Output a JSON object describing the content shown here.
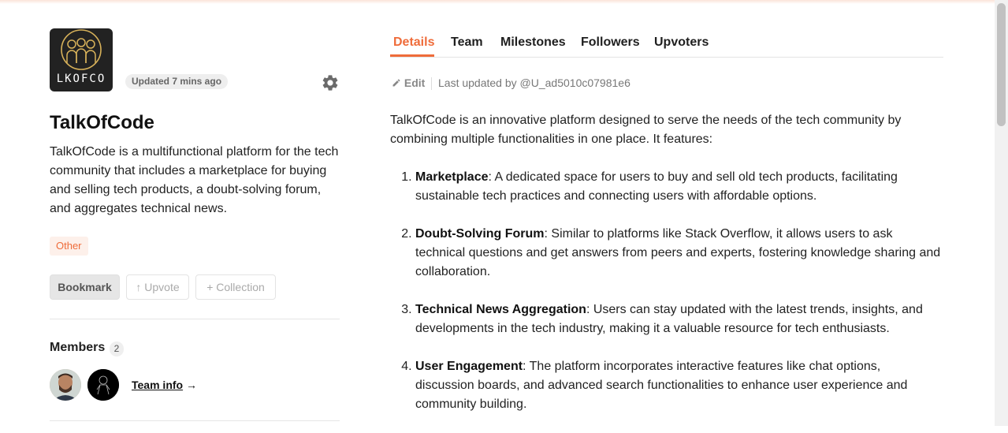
{
  "project": {
    "logo_text": "LKOFCO",
    "updated": "Updated 7 mins ago",
    "title": "TalkOfCode",
    "description": "TalkOfCode is a multifunctional platform for the tech community that includes a marketplace for buying and selling tech products, a doubt-solving forum, and aggregates technical news.",
    "tag": "Other"
  },
  "actions": {
    "bookmark": "Bookmark",
    "upvote": "↑ Upvote",
    "collection": "+ Collection"
  },
  "members": {
    "label": "Members",
    "count": "2",
    "team_info": "Team info",
    "team_info_arrow": "→"
  },
  "tabs": [
    "Details",
    "Team",
    "Milestones",
    "Followers",
    "Upvoters"
  ],
  "active_tab": "Details",
  "meta": {
    "edit": "Edit",
    "last_updated": "Last updated by @U_ad5010c07981e6"
  },
  "content": {
    "intro": "TalkOfCode is an innovative platform designed to serve the needs of the tech community by combining multiple functionalities in one place. It features:",
    "features": [
      {
        "title": "Marketplace",
        "text": ": A dedicated space for users to buy and sell old tech products, facilitating sustainable tech practices and connecting users with affordable options."
      },
      {
        "title": "Doubt-Solving Forum",
        "text": ": Similar to platforms like Stack Overflow, it allows users to ask technical questions and get answers from peers and experts, fostering knowledge sharing and collaboration."
      },
      {
        "title": "Technical News Aggregation",
        "text": ": Users can stay updated with the latest trends, insights, and developments in the tech industry, making it a valuable resource for tech enthusiasts."
      },
      {
        "title": "User Engagement",
        "text": ": The platform incorporates interactive features like chat options, discussion boards, and advanced search functionalities to enhance user experience and community building."
      }
    ]
  },
  "colors": {
    "accent": "#ef6c3a",
    "tag_bg": "#fdf0ea",
    "logo_bg": "#222222",
    "logo_line": "#d8b25a"
  },
  "icons": {
    "settings": "gear-icon",
    "edit": "pencil-icon"
  }
}
